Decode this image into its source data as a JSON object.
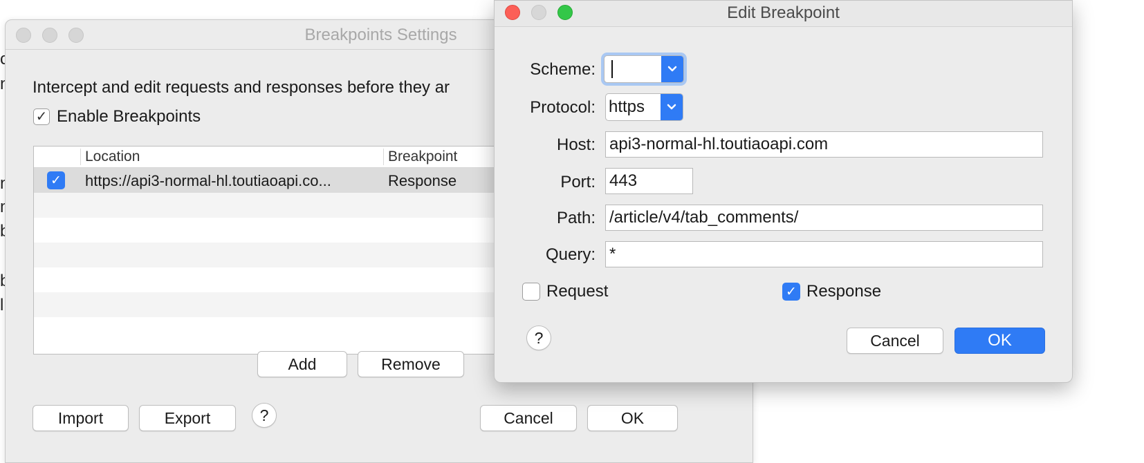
{
  "edge": {
    "letters": [
      "c",
      "n",
      "n",
      "m",
      "b",
      "b",
      "l"
    ]
  },
  "back_window": {
    "title": "Breakpoints Settings",
    "intro": "Intercept and edit requests and responses before they ar",
    "enable_label": "Enable Breakpoints",
    "enable_checked": true,
    "table": {
      "headers": [
        "Location",
        "Breakpoint"
      ],
      "rows": [
        {
          "checked": true,
          "location": "https://api3-normal-hl.toutiaoapi.co...",
          "breakpoint": "Response"
        }
      ]
    },
    "buttons": {
      "add": "Add",
      "remove": "Remove",
      "import": "Import",
      "export": "Export",
      "help": "?",
      "cancel": "Cancel",
      "ok": "OK"
    }
  },
  "dialog": {
    "title": "Edit Breakpoint",
    "labels": {
      "scheme": "Scheme:",
      "protocol": "Protocol:",
      "host": "Host:",
      "port": "Port:",
      "path": "Path:",
      "query": "Query:"
    },
    "values": {
      "scheme": "",
      "protocol": "https",
      "host": "api3-normal-hl.toutiaoapi.com",
      "port": "443",
      "path": "/article/v4/tab_comments/",
      "query": "*"
    },
    "request_label": "Request",
    "request_checked": false,
    "response_label": "Response",
    "response_checked": true,
    "buttons": {
      "help": "?",
      "cancel": "Cancel",
      "ok": "OK"
    }
  },
  "icons": {
    "check": "✓",
    "chevron": "⌄"
  },
  "colors": {
    "accent": "#2f7bf5",
    "close": "#fc5f57",
    "zoom": "#33c748"
  }
}
